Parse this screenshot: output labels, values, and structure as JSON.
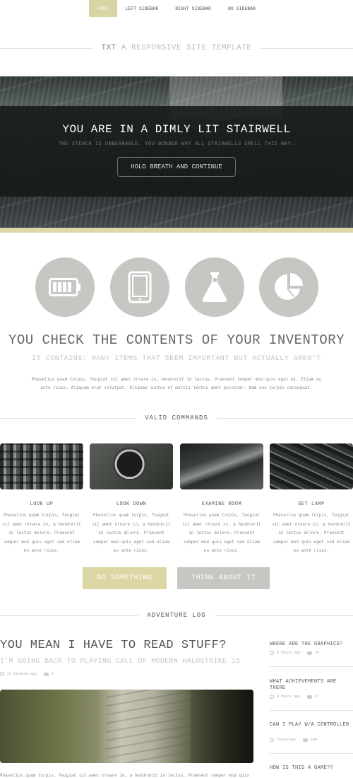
{
  "nav": {
    "items": [
      {
        "label": "HOME",
        "active": true
      },
      {
        "label": "LEFT SIDEBAR",
        "active": false
      },
      {
        "label": "RIGHT SIDEBAR",
        "active": false
      },
      {
        "label": "NO SIDEBAR",
        "active": false
      }
    ]
  },
  "site": {
    "name": "TXT",
    "tagline": "A RESPONSIVE SITE TEMPLATE"
  },
  "hero": {
    "title": "YOU ARE IN A DIMLY LIT STAIRWELL",
    "subtitle": "THE STENCH IS UNBEARABLE. YOU WONDER WHY ALL STAIRWELLS SMELL THIS WAY.",
    "button": "HOLD BREATH AND CONTINUE"
  },
  "icons": [
    "battery-icon",
    "tablet-icon",
    "flask-icon",
    "pie-chart-icon"
  ],
  "inventory": {
    "title": "YOU CHECK THE CONTENTS OF YOUR INVENTORY",
    "subtitle": "IT CONTAINS: MANY ITEMS THAT SEEM IMPORTANT BUT ACTUALLY AREN'T",
    "paragraph": "Phasellus quam turpis, feugiat sit amet ornare in, hendrerit in lectus. Praesent semper mod quis eget mi. Etiam eu ante risus. Aliquam erat volutpat. Aliquam luctus et mattis lectus amet pulvinar. Nam nec turpis consequat."
  },
  "commands": {
    "heading": "VALID COMMANDS",
    "cards": [
      {
        "title": "LOOK UP",
        "text": "Phasellus quam turpis, feugiat sit amet ornare in, a hendrerit in lectus dolore. Praesent semper mod quis eget sed etiam eu ante risus."
      },
      {
        "title": "LOOK DOWN",
        "text": "Phasellus quam turpis, feugiat sit amet ornare in, a hendrerit in lectus dolore. Praesent semper mod quis eget sed etiam eu ante risus."
      },
      {
        "title": "EXAMINE ROOM",
        "text": "Phasellus quam turpis, feugiat sit amet ornare in, a hendrerit in lectus dolore. Praesent semper mod quis eget sed etiam eu ante risus."
      },
      {
        "title": "GET LAMP",
        "text": "Phasellus quam turpis, feugiat sit amet ornare in, a hendrerit in lectus dolore. Praesent semper mod quis eget sed etiam eu ante risus."
      }
    ],
    "primary_button": "DO SOMETHING",
    "secondary_button": "THINK ABOUT IT"
  },
  "log": {
    "heading": "ADVENTURE LOG",
    "post": {
      "title": "YOU MEAN I HAVE TO READ STUFF?",
      "subtitle": "I'M GOING BACK TO PLAYING CALL OF MODERN HALOSTRIKE 15",
      "time": "15 minutes ago",
      "comments": "8",
      "paragraph": "Phasellus quam turpis, feugiat sit amet ornare in, a hendrerit in lectus. Praesent semper mod quis"
    },
    "sidebar": [
      {
        "title": "WHERE ARE THE GRAPHICS?",
        "time": "6 hours ago",
        "comments": "34"
      },
      {
        "title": "WHAT ACHIEVEMENTS ARE THERE",
        "time": "9 hours ago",
        "comments": "27"
      },
      {
        "title": "CAN I PLAY W/A CONTROLLER",
        "time": "Yesterday",
        "comments": "184"
      },
      {
        "title": "HOW IS THIS A GAME??",
        "time": "",
        "comments": ""
      }
    ]
  },
  "colors": {
    "accent": "#dcd6a4",
    "secondary": "#c4c7c2",
    "hero_band": "#141a18"
  }
}
